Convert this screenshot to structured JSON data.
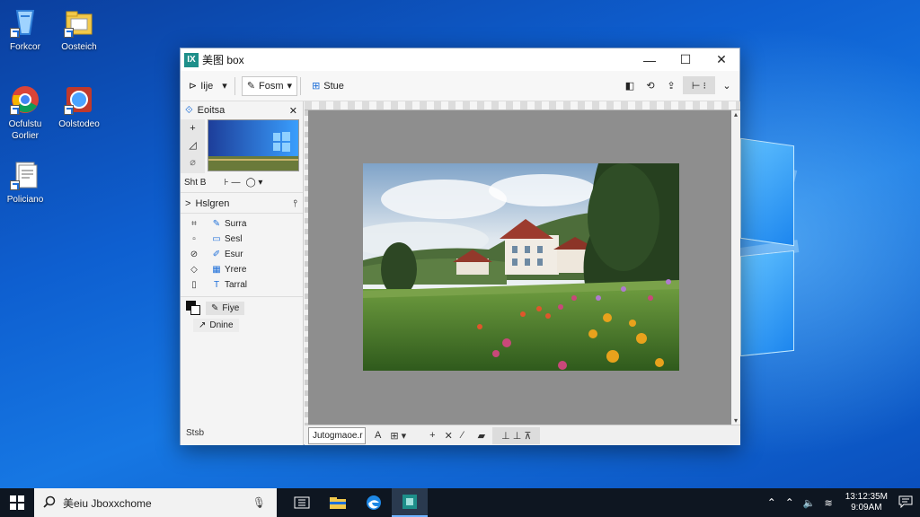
{
  "desktop": {
    "icons": [
      {
        "label": "Forkcor"
      },
      {
        "label": "Oosteich"
      },
      {
        "label": "Ocfulstu Gorlier"
      },
      {
        "label": "Oolstodeo"
      },
      {
        "label": "Policiano"
      }
    ]
  },
  "window": {
    "icon_text": "IX",
    "title": "美图 box",
    "controls": {
      "minimize": "—",
      "maximize": "☐",
      "close": "✕"
    }
  },
  "toolbar": {
    "file_label": "Iije",
    "form_label": "Fosm",
    "slide_label": "Stue"
  },
  "left_panel": {
    "section1_title": "Eoitsa",
    "size_label": "Sht B",
    "section2_title": "Hslgren",
    "rows": [
      {
        "label": "Surra"
      },
      {
        "label": "Sesl"
      },
      {
        "label": "Esur"
      },
      {
        "label": "Yrere"
      },
      {
        "label": "Tarral"
      }
    ],
    "frame_label": "Fiye",
    "drive_label": "Dnine",
    "footer": "Stsb"
  },
  "statusbar": {
    "zoom_value": "Jutogmaoe.r"
  },
  "taskbar": {
    "search_text": "美eiu Jboxxchome",
    "time": "13:12:35M",
    "date": "9:09AM"
  },
  "colors": {
    "accent": "#1e6fd9",
    "taskbar": "#0e1621",
    "canvas": "#8e8e8e"
  }
}
